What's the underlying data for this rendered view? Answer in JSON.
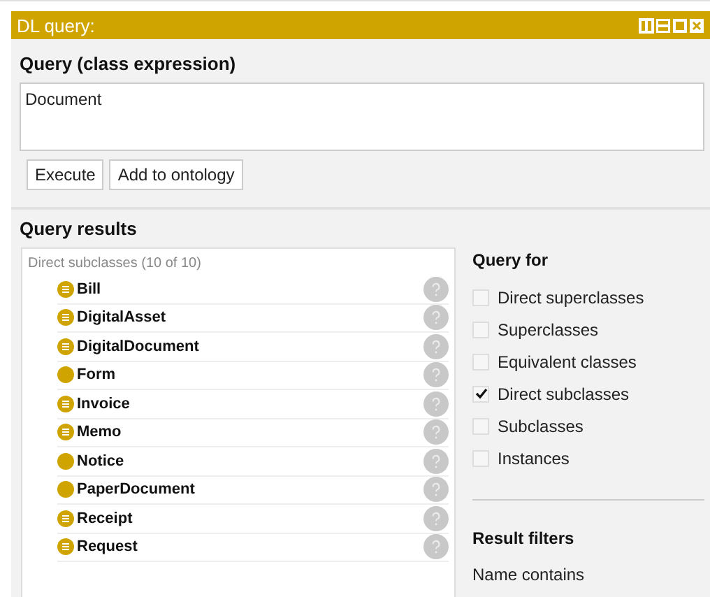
{
  "window": {
    "title": "DL query:"
  },
  "query": {
    "heading": "Query (class expression)",
    "value": "Document",
    "buttons": [
      "Execute",
      "Add to ontology"
    ]
  },
  "results": {
    "heading": "Query results",
    "list_title": "Direct subclasses (10 of 10)",
    "items": [
      {
        "label": "Bill",
        "kind": "defined"
      },
      {
        "label": "DigitalAsset",
        "kind": "defined"
      },
      {
        "label": "DigitalDocument",
        "kind": "defined"
      },
      {
        "label": "Form",
        "kind": "primitive"
      },
      {
        "label": "Invoice",
        "kind": "defined"
      },
      {
        "label": "Memo",
        "kind": "defined"
      },
      {
        "label": "Notice",
        "kind": "primitive"
      },
      {
        "label": "PaperDocument",
        "kind": "primitive"
      },
      {
        "label": "Receipt",
        "kind": "defined"
      },
      {
        "label": "Request",
        "kind": "defined"
      }
    ]
  },
  "query_for": {
    "heading": "Query for",
    "options": [
      {
        "label": "Direct superclasses",
        "checked": false
      },
      {
        "label": "Superclasses",
        "checked": false
      },
      {
        "label": "Equivalent classes",
        "checked": false
      },
      {
        "label": "Direct subclasses",
        "checked": true
      },
      {
        "label": "Subclasses",
        "checked": false
      },
      {
        "label": "Instances",
        "checked": false
      }
    ]
  },
  "filters": {
    "heading": "Result filters",
    "name_label": "Name contains"
  }
}
